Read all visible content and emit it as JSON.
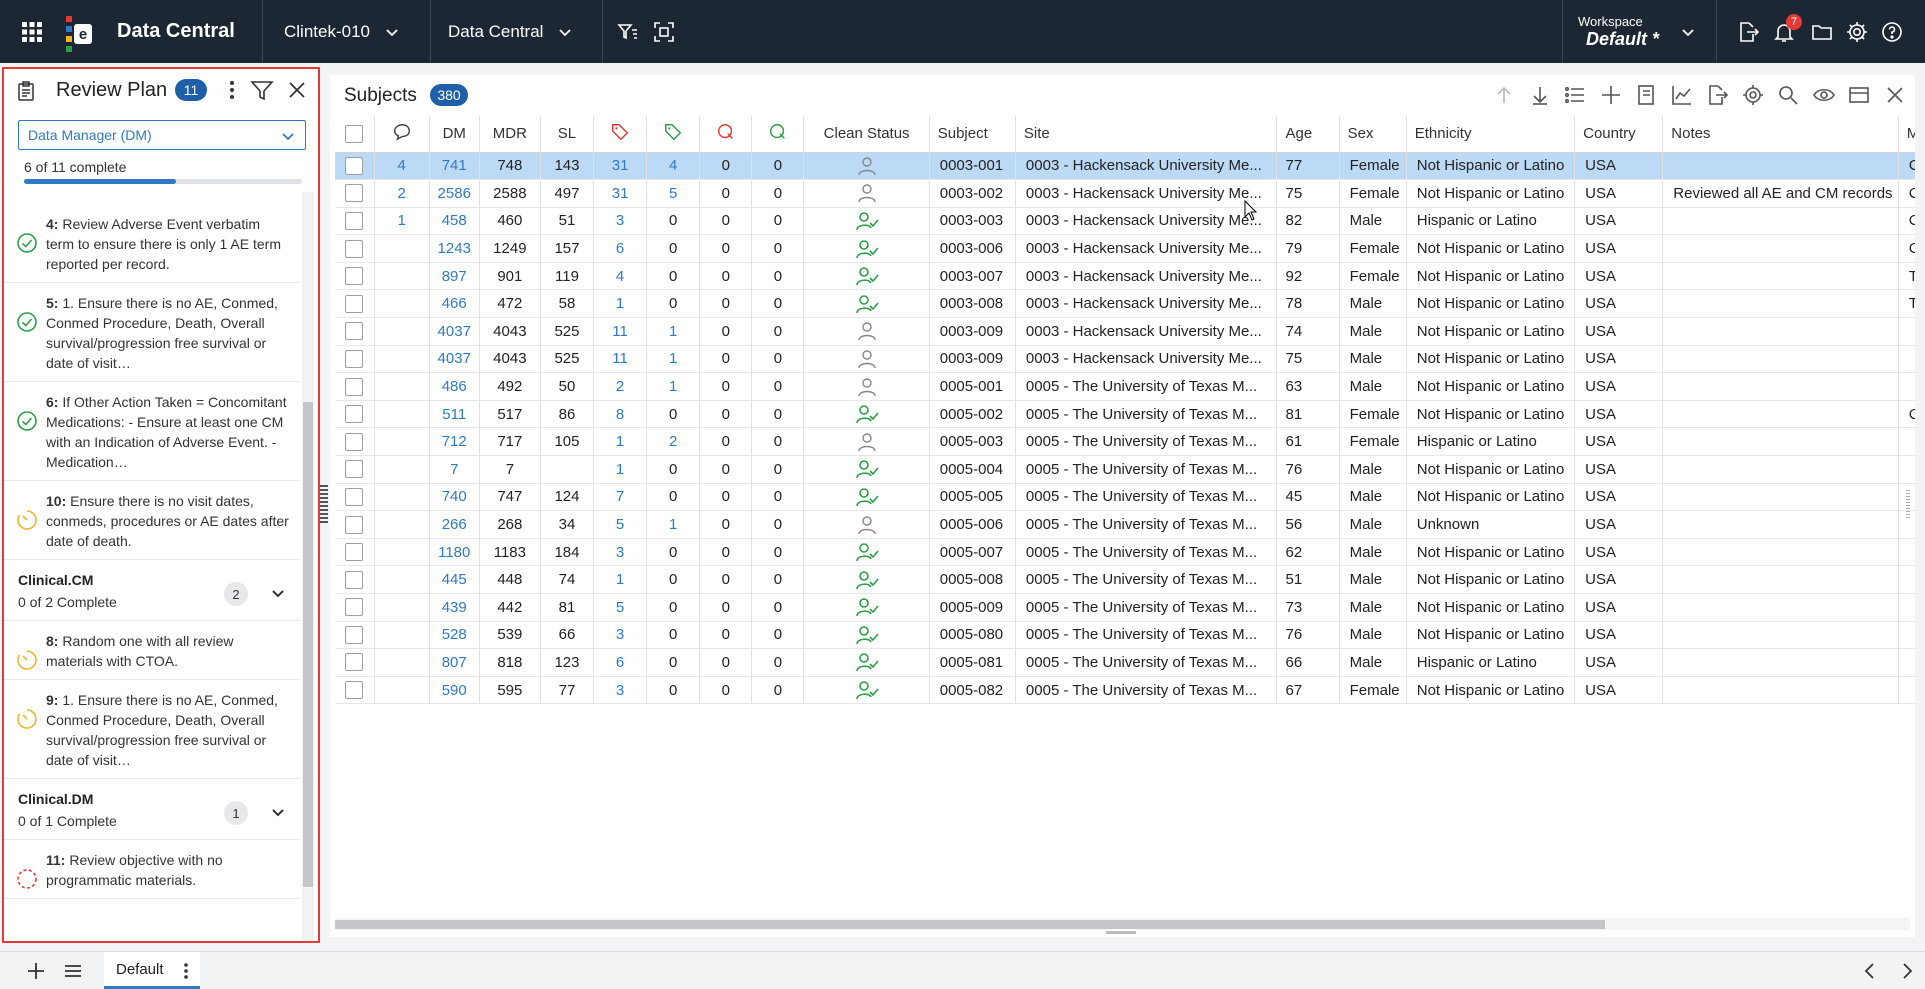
{
  "app": {
    "title": "Data Central",
    "study": "Clintek-010",
    "module": "Data Central",
    "workspace_label": "Workspace",
    "workspace_value": "Default",
    "workspace_star": "*",
    "notif_count": "7"
  },
  "panel": {
    "title": "Review Plan",
    "count": "11",
    "role": "Data Manager (DM)",
    "progress_text": "6 of 11 complete",
    "progress": 0.545,
    "items": [
      {
        "num": "4:",
        "text": "Review Adverse Event verbatim term to ensure there is only 1 AE term reported per record.",
        "status": "complete"
      },
      {
        "num": "5:",
        "text": "1. Ensure there is no AE, Conmed, Conmed Procedure, Death, Overall survival/progression free survival or date of visit…",
        "status": "complete"
      },
      {
        "num": "6:",
        "text": "If Other Action Taken = Concomitant Medications: - Ensure at least one CM with an Indication of Adverse Event. - Medication…",
        "status": "complete"
      },
      {
        "num": "10:",
        "text": "Ensure there is no visit dates, conmeds, procedures or AE dates after date of death.",
        "status": "in-progress"
      }
    ],
    "groups": [
      {
        "name": "Clinical.CM",
        "sub": "0 of 2 Complete",
        "count": "2",
        "items": [
          {
            "num": "8:",
            "text": "Random one with all review materials with CTOA.",
            "status": "in-progress"
          },
          {
            "num": "9:",
            "text": "1. Ensure there is no AE, Conmed, Conmed Procedure, Death, Overall survival/progression free survival or date of visit…",
            "status": "in-progress"
          }
        ]
      },
      {
        "name": "Clinical.DM",
        "sub": "0 of 1 Complete",
        "count": "1",
        "items": [
          {
            "num": "11:",
            "text": "Review objective with no programmatic materials.",
            "status": "not-started"
          }
        ]
      }
    ]
  },
  "grid": {
    "title": "Subjects",
    "count": "380",
    "columns": [
      "",
      "",
      "DM",
      "MDR",
      "SL",
      "",
      "",
      "",
      "",
      "Clean Status",
      "Subject",
      "Site",
      "Age",
      "Sex",
      "Ethnicity",
      "Country",
      "Notes",
      "M"
    ],
    "rows": [
      [
        "4",
        "741",
        "748",
        "143",
        "31",
        "4",
        "0",
        "0",
        "single",
        "0003-001",
        "0003 - Hackensack University Me...",
        "77",
        "Female",
        "Not Hispanic or Latino",
        "USA",
        "",
        "C"
      ],
      [
        "2",
        "2586",
        "2588",
        "497",
        "31",
        "5",
        "0",
        "0",
        "single",
        "0003-002",
        "0003 - Hackensack University Me...",
        "75",
        "Female",
        "Not Hispanic or Latino",
        "USA",
        "Reviewed all AE and CM records",
        "C"
      ],
      [
        "1",
        "458",
        "460",
        "51",
        "3",
        "0",
        "0",
        "0",
        "clean",
        "0003-003",
        "0003 - Hackensack University Me...",
        "82",
        "Male",
        "Hispanic or Latino",
        "USA",
        "",
        "C"
      ],
      [
        "",
        "1243",
        "1249",
        "157",
        "6",
        "0",
        "0",
        "0",
        "clean",
        "0003-006",
        "0003 - Hackensack University Me...",
        "79",
        "Female",
        "Not Hispanic or Latino",
        "USA",
        "",
        "C"
      ],
      [
        "",
        "897",
        "901",
        "119",
        "4",
        "0",
        "0",
        "0",
        "clean",
        "0003-007",
        "0003 - Hackensack University Me...",
        "92",
        "Female",
        "Not Hispanic or Latino",
        "USA",
        "",
        "T"
      ],
      [
        "",
        "466",
        "472",
        "58",
        "1",
        "0",
        "0",
        "0",
        "clean",
        "0003-008",
        "0003 - Hackensack University Me...",
        "78",
        "Male",
        "Not Hispanic or Latino",
        "USA",
        "",
        "T"
      ],
      [
        "",
        "4037",
        "4043",
        "525",
        "11",
        "1",
        "0",
        "0",
        "single",
        "0003-009",
        "0003 - Hackensack University Me...",
        "74",
        "Male",
        "Not Hispanic or Latino",
        "USA",
        "",
        ""
      ],
      [
        "",
        "4037",
        "4043",
        "525",
        "11",
        "1",
        "0",
        "0",
        "single",
        "0003-009",
        "0003 - Hackensack University Me...",
        "75",
        "Male",
        "Not Hispanic or Latino",
        "USA",
        "",
        ""
      ],
      [
        "",
        "486",
        "492",
        "50",
        "2",
        "1",
        "0",
        "0",
        "single",
        "0005-001",
        "0005 - The University of Texas M...",
        "63",
        "Male",
        "Not Hispanic or Latino",
        "USA",
        "",
        ""
      ],
      [
        "",
        "511",
        "517",
        "86",
        "8",
        "0",
        "0",
        "0",
        "clean",
        "0005-002",
        "0005 - The University of Texas M...",
        "81",
        "Female",
        "Not Hispanic or Latino",
        "USA",
        "",
        "C"
      ],
      [
        "",
        "712",
        "717",
        "105",
        "1",
        "2",
        "0",
        "0",
        "single",
        "0005-003",
        "0005 - The University of Texas M...",
        "61",
        "Female",
        "Hispanic or Latino",
        "USA",
        "",
        ""
      ],
      [
        "",
        "7",
        "7",
        "",
        "1",
        "0",
        "0",
        "0",
        "clean",
        "0005-004",
        "0005 - The University of Texas M...",
        "76",
        "Male",
        "Not Hispanic or Latino",
        "USA",
        "",
        ""
      ],
      [
        "",
        "740",
        "747",
        "124",
        "7",
        "0",
        "0",
        "0",
        "clean",
        "0005-005",
        "0005 - The University of Texas M...",
        "45",
        "Male",
        "Not Hispanic or Latino",
        "USA",
        "",
        ""
      ],
      [
        "",
        "266",
        "268",
        "34",
        "5",
        "1",
        "0",
        "0",
        "single",
        "0005-006",
        "0005 - The University of Texas M...",
        "56",
        "Male",
        "Unknown",
        "USA",
        "",
        ""
      ],
      [
        "",
        "1180",
        "1183",
        "184",
        "3",
        "0",
        "0",
        "0",
        "clean",
        "0005-007",
        "0005 - The University of Texas M...",
        "62",
        "Male",
        "Not Hispanic or Latino",
        "USA",
        "",
        ""
      ],
      [
        "",
        "445",
        "448",
        "74",
        "1",
        "0",
        "0",
        "0",
        "clean",
        "0005-008",
        "0005 - The University of Texas M...",
        "51",
        "Male",
        "Not Hispanic or Latino",
        "USA",
        "",
        ""
      ],
      [
        "",
        "439",
        "442",
        "81",
        "5",
        "0",
        "0",
        "0",
        "clean",
        "0005-009",
        "0005 - The University of Texas M...",
        "73",
        "Male",
        "Not Hispanic or Latino",
        "USA",
        "",
        ""
      ],
      [
        "",
        "528",
        "539",
        "66",
        "3",
        "0",
        "0",
        "0",
        "clean",
        "0005-080",
        "0005 - The University of Texas M...",
        "76",
        "Male",
        "Not Hispanic or Latino",
        "USA",
        "",
        ""
      ],
      [
        "",
        "807",
        "818",
        "123",
        "6",
        "0",
        "0",
        "0",
        "clean",
        "0005-081",
        "0005 - The University of Texas M...",
        "66",
        "Male",
        "Hispanic or Latino",
        "USA",
        "",
        ""
      ],
      [
        "",
        "590",
        "595",
        "77",
        "3",
        "0",
        "0",
        "0",
        "clean",
        "0005-082",
        "0005 - The University of Texas M...",
        "67",
        "Female",
        "Not Hispanic or Latino",
        "USA",
        "",
        ""
      ]
    ]
  },
  "bottom": {
    "tab": "Default"
  },
  "colors": {
    "topbar": "#1c2733",
    "accent": "#2f7ac2",
    "selected_row": "#bcdaf6",
    "complete": "#2e9e48",
    "in_progress": "#f0b429",
    "not_started": "#e53935",
    "panel_border": "#e53935"
  }
}
